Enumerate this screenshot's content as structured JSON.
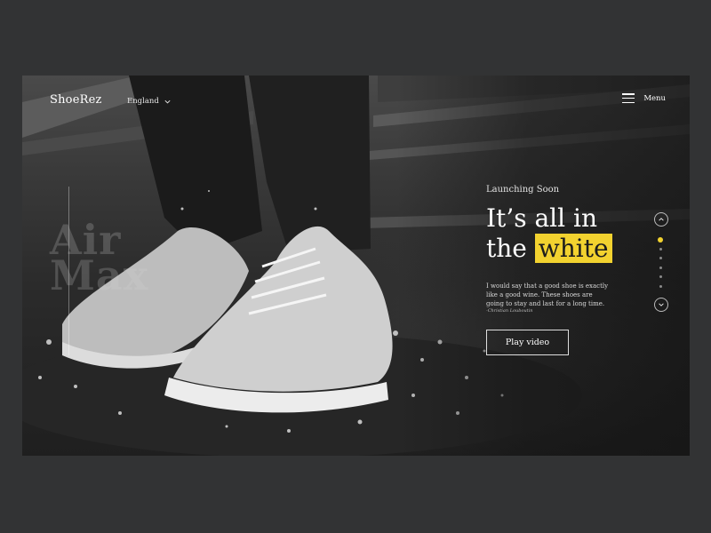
{
  "header": {
    "logo": "ShoeRez",
    "language": "England",
    "menu_label": "Menu"
  },
  "hero": {
    "brand_watermark_line1": "Air",
    "brand_watermark_line2": "Max",
    "image_description": "black and white photo of white sneakers splashing in water"
  },
  "content": {
    "kicker": "Launching Soon",
    "headline_line1": "It’s all in",
    "headline_prefix": "the",
    "headline_highlight": "white",
    "description": "I would say that a good shoe is exactly like a good wine. These shoes are going to stay and last for a long time.",
    "quote_author": "-Christian Louboutin",
    "cta_label": "Play video"
  },
  "slider": {
    "total_dots": 6,
    "active_index": 0
  },
  "colors": {
    "page_bg": "#323334",
    "accent": "#f2d22f",
    "text": "#ffffff"
  },
  "icons": [
    "chevron-down-icon",
    "hamburger-icon",
    "chevron-up-icon",
    "chevron-down-icon"
  ]
}
